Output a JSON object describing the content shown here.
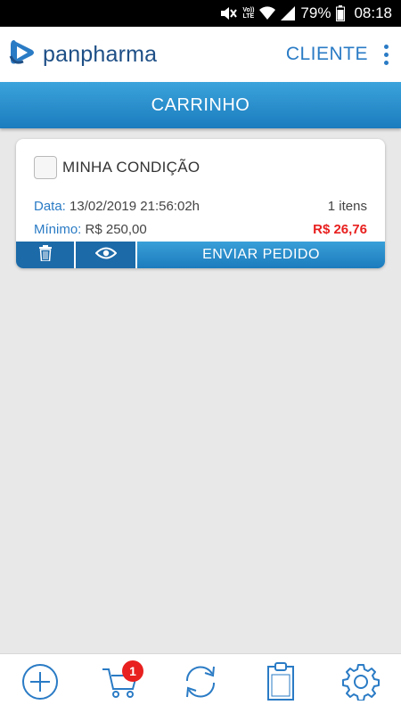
{
  "status_bar": {
    "battery_percent": "79%",
    "time": "08:18",
    "icons": [
      "mute-icon",
      "volte-icon",
      "wifi-icon",
      "signal-icon",
      "battery-icon"
    ]
  },
  "header": {
    "logo_text": "panpharma",
    "cliente_label": "CLIENTE",
    "menu_icon": "more-vert-icon"
  },
  "title": "CARRINHO",
  "cart": {
    "condition_label": "MINHA CONDIÇÃO",
    "checked": false,
    "date_label": "Data:",
    "date_value": "13/02/2019 21:56:02h",
    "items_text": "1 itens",
    "minimum_label": "Mínimo:",
    "minimum_value": "R$ 250,00",
    "total": "R$ 26,76",
    "send_label": "ENVIAR PEDIDO",
    "colors": {
      "accent": "#2a7bc5",
      "total": "#e8201f",
      "action": "#1c6aa8"
    }
  },
  "bottom_nav": {
    "items": [
      {
        "icon": "add-circle-icon"
      },
      {
        "icon": "cart-icon",
        "badge": "1"
      },
      {
        "icon": "sync-icon"
      },
      {
        "icon": "clipboard-icon"
      },
      {
        "icon": "settings-gear-icon"
      }
    ]
  }
}
